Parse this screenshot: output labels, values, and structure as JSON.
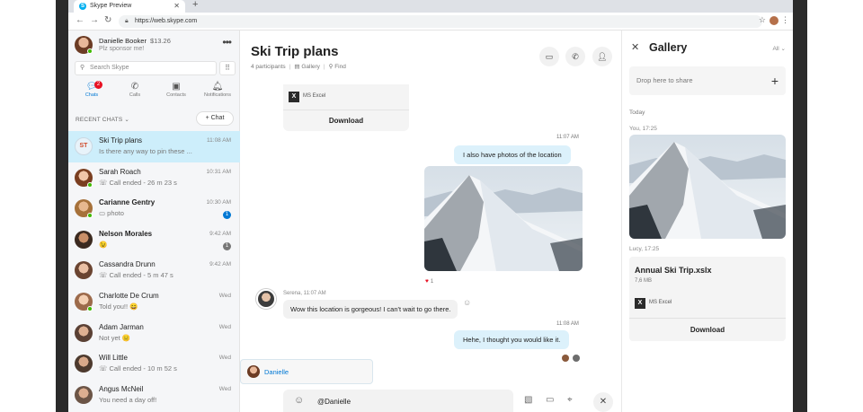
{
  "browser": {
    "tab_title": "Skype Preview",
    "url": "https://web.skype.com"
  },
  "profile": {
    "name": "Danielle Booker",
    "credit": "$13.26",
    "mood": "Plz sponsor me!"
  },
  "search": {
    "placeholder": "Search Skype"
  },
  "nav": {
    "chats": "Chats",
    "chats_badge": "2",
    "calls": "Calls",
    "contacts": "Contacts",
    "notifications": "Notifications"
  },
  "recent_label": "RECENT CHATS",
  "new_chat_label": "+ Chat",
  "chats": [
    {
      "name": "Ski Trip plans",
      "preview": "Is there any way to pin these ...",
      "time": "11:08 AM",
      "initials": "ST",
      "selected": true
    },
    {
      "name": "Sarah Roach",
      "preview": "Call ended - 26 m 23 s",
      "time": "10:31 AM",
      "online": true
    },
    {
      "name": "Carianne Gentry",
      "preview": "photo",
      "time": "10:30 AM",
      "bold": true,
      "badge": "1",
      "online": true
    },
    {
      "name": "Nelson Morales",
      "preview": "",
      "time": "9:42 AM",
      "bold": true,
      "badge": "1"
    },
    {
      "name": "Cassandra Drunn",
      "preview": "Call ended - 5 m 47 s",
      "time": "9:42 AM"
    },
    {
      "name": "Charlotte De Crum",
      "preview": "Told you!!",
      "time": "Wed",
      "online": true
    },
    {
      "name": "Adam Jarman",
      "preview": "Not yet",
      "time": "Wed"
    },
    {
      "name": "Will Little",
      "preview": "Call ended - 10 m 52 s",
      "time": "Wed"
    },
    {
      "name": "Angus McNeil",
      "preview": "You need a day off!",
      "time": "Wed"
    }
  ],
  "conversation": {
    "title": "Ski Trip plans",
    "participants": "4 participants",
    "gallery": "Gallery",
    "find": "Find",
    "file_name": "MS Excel",
    "download": "Download",
    "time_1": "11:07 AM",
    "msg_photos": "I also have photos of the location",
    "reaction_count": "1",
    "serena_meta": "Serena, 11:07 AM",
    "msg_serena": "Wow this location is gorgeous! I can't wait to go there.",
    "time_2": "11:08 AM",
    "msg_reply": "Hehe, I thought you would like it.",
    "mention_name": "Danielle",
    "composer_text": "@Danielle"
  },
  "gallery": {
    "title": "Gallery",
    "filter": "All",
    "drop_label": "Drop here to share",
    "day": "Today",
    "photo_by": "You, 17:25",
    "file_by": "Lucy, 17:25",
    "file_name": "Annual Ski Trip.xslx",
    "file_size": "7,6 MB",
    "file_type": "MS Excel",
    "download": "Download"
  },
  "colors": {
    "accent": "#0078d4",
    "selected_chat": "#cdeefb",
    "my_bubble": "#dcf1fb",
    "online": "#3fb900"
  }
}
